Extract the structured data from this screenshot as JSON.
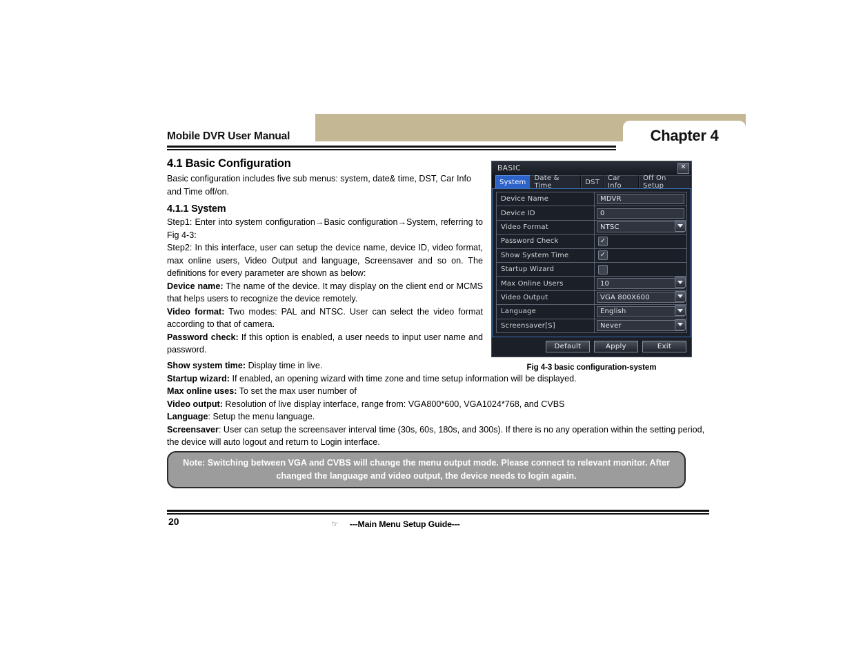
{
  "header": {
    "manual_title": "Mobile DVR User Manual",
    "chapter_label": "Chapter 4"
  },
  "section": {
    "number_title": "4.1  Basic Configuration",
    "intro": "Basic configuration includes five sub menus: system, date& time, DST, Car Info and Time off/on.",
    "subsection_title": "4.1.1  System",
    "step1": "Step1: Enter into system configuration→Basic configuration→System, referring to Fig 4-3:",
    "step2": "Step2: In this interface, user can setup the device name, device ID, video format, max online users, Video Output and language, Screensaver and so on. The definitions for every parameter are shown as below:"
  },
  "definitions": [
    {
      "term": "Device name:",
      "text": " The name of the device. It may display on the client end or MCMS that helps users to recognize the device remotely."
    },
    {
      "term": "Video format:",
      "text": " Two modes: PAL and NTSC. User can select the video format according to that of camera."
    },
    {
      "term": "Password check:",
      "text": " If this option is enabled, a user needs to input user name and password."
    },
    {
      "term": "Show system time:",
      "text": " Display time in live."
    },
    {
      "term": "Startup wizard:",
      "text": " If enabled, an opening wizard with time zone and time setup information will be displayed."
    },
    {
      "term": "Max online uses:",
      "text": " To set the max user number of"
    },
    {
      "term": "Video output:",
      "text": " Resolution of live display interface, range from: VGA800*600, VGA1024*768, and CVBS"
    },
    {
      "term": "Language",
      "text": ": Setup the menu language."
    },
    {
      "term": "Screensaver",
      "text": ": User can setup the screensaver interval time (30s, 60s, 180s, and 300s). If there is no any operation within the setting period, the device will auto logout and return to Login interface."
    }
  ],
  "note": {
    "text": "Note: Switching between VGA and CVBS will change the menu output mode. Please connect to relevant monitor. After changed the language and video output, the device needs to login again."
  },
  "footer": {
    "page_number": "20",
    "center_text": "---Main Menu Setup Guide---",
    "hand_icon": "☞"
  },
  "figure": {
    "caption": "Fig 4-3 basic configuration-system"
  },
  "dialog": {
    "title": "BASIC",
    "close_label": "✕",
    "tabs": [
      {
        "label": "System",
        "active": true
      },
      {
        "label": "Date & Time",
        "active": false
      },
      {
        "label": "DST",
        "active": false
      },
      {
        "label": "Car Info",
        "active": false
      },
      {
        "label": "Off On Setup",
        "active": false
      }
    ],
    "rows": [
      {
        "label": "Device Name",
        "type": "input",
        "value": "MDVR"
      },
      {
        "label": "Device ID",
        "type": "input",
        "value": "0"
      },
      {
        "label": "Video Format",
        "type": "select",
        "value": "NTSC"
      },
      {
        "label": "Password Check",
        "type": "checkbox",
        "checked": true
      },
      {
        "label": "Show System Time",
        "type": "checkbox",
        "checked": true
      },
      {
        "label": "Startup Wizard",
        "type": "checkbox",
        "checked": false
      },
      {
        "label": "Max Online Users",
        "type": "select",
        "value": "10"
      },
      {
        "label": "Video Output",
        "type": "select",
        "value": "VGA 800X600"
      },
      {
        "label": "Language",
        "type": "select",
        "value": "English"
      },
      {
        "label": "Screensaver[S]",
        "type": "select",
        "value": "Never"
      }
    ],
    "buttons": [
      {
        "label": "Default"
      },
      {
        "label": "Apply"
      },
      {
        "label": "Exit"
      }
    ]
  },
  "colors": {
    "header_band": "#c4b894",
    "note_bg": "#9c9c9c",
    "tab_active": "#2d62c8",
    "dialog_bg": "#1b1f28"
  }
}
